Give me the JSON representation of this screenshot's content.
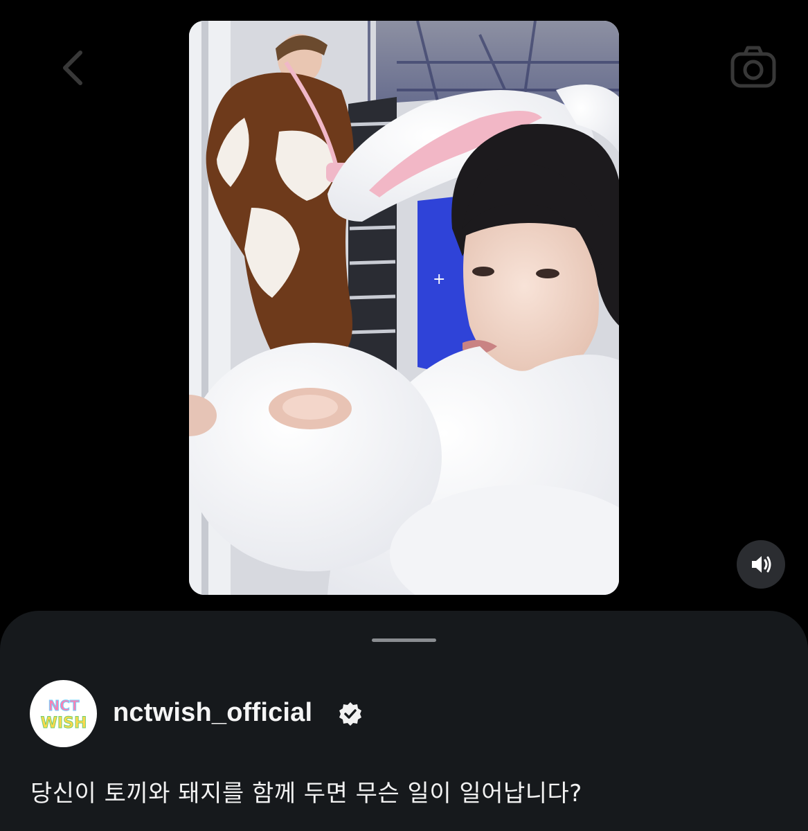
{
  "header": {
    "back_icon": "chevron-left-icon",
    "camera_icon": "camera-icon"
  },
  "media": {
    "type": "video",
    "volume_icon": "speaker-volume-icon"
  },
  "post": {
    "username": "nctwish_official",
    "verified": true,
    "verified_icon": "verified-badge-icon",
    "avatar_logo": "NCT WISH",
    "caption": "당신이 토끼와 돼지를 함께 두면 무슨 일이 일어납니다?"
  },
  "colors": {
    "background": "#000000",
    "sheet": "#16191c",
    "grabber": "#8a8d91",
    "volume_button": "#2b2d31"
  }
}
